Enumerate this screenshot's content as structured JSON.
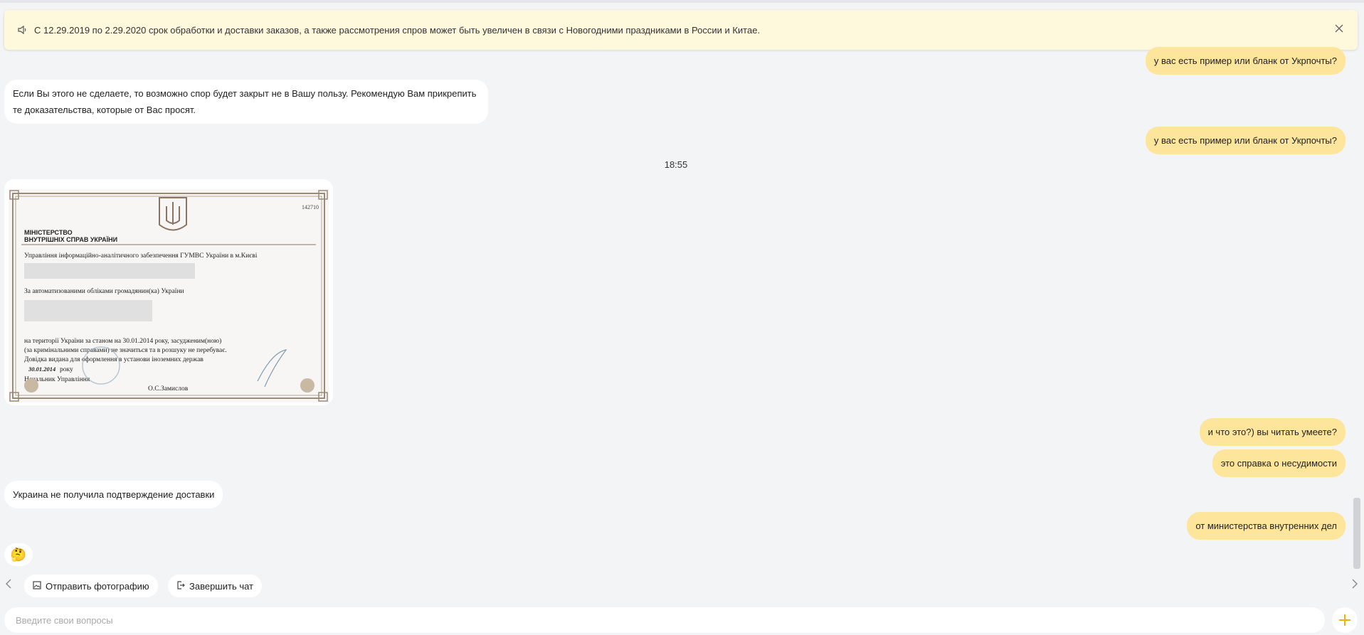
{
  "banner": {
    "text": "С 12.29.2019 по 2.29.2020 срок обработки и доставки заказов, а также рассмотрения спров может быть увеличен в связи с Новогодними праздниками в России и Китае.",
    "icon": "speaker-icon",
    "close_icon": "close-icon"
  },
  "messages": {
    "m1": "у вас есть пример или бланк от Укрпочты?",
    "m2": "Если Вы этого не сделаете, то возможно спор будет закрыт не в Вашу пользу. Рекомендую Вам прикрепить те доказательства, которые от Вас просят.",
    "m3": "у вас есть пример или бланк от Укрпочты?",
    "time": "18:55",
    "m4": "и что это?) вы читать умеете?",
    "m5": "это справка о несудимости",
    "m6": "Украина не получила подтверждение доставки",
    "m7": "от министерства внутренних дел",
    "m8": "🤔"
  },
  "certificate": {
    "number": "142710",
    "ministry_line1": "МІНІСТЕРСТВО",
    "ministry_line2": "ВНУТРІШНІХ СПРАВ УКРАЇНИ",
    "department": "Управління інформаційно-аналітичного забезпечення  ГУМВС України в м.Києві",
    "records": "За автоматизованими обліками громадянин(ка) України",
    "territory": "на території України за станом на  30.01.2014  року,  засудженим(ною)",
    "criminal": "(за кримінальними справами) не значиться та в розшуку не перебуває.",
    "issued": "Довідка видана для оформлення   в установи іноземних держав",
    "date": "30.01.2014",
    "date_suffix": "року",
    "chief": "Начальник Управління",
    "signatory": "О.С.Замислов"
  },
  "actions": {
    "send_photo": "Отправить фотографию",
    "end_chat": "Завершить чат",
    "photo_icon": "image-icon",
    "exit_icon": "exit-icon"
  },
  "composer": {
    "placeholder": "Введите свои вопросы",
    "add_icon": "plus-icon"
  },
  "colors": {
    "outgoing": "#fde59c",
    "banner": "#fef8dc",
    "accent": "#f2b200"
  }
}
